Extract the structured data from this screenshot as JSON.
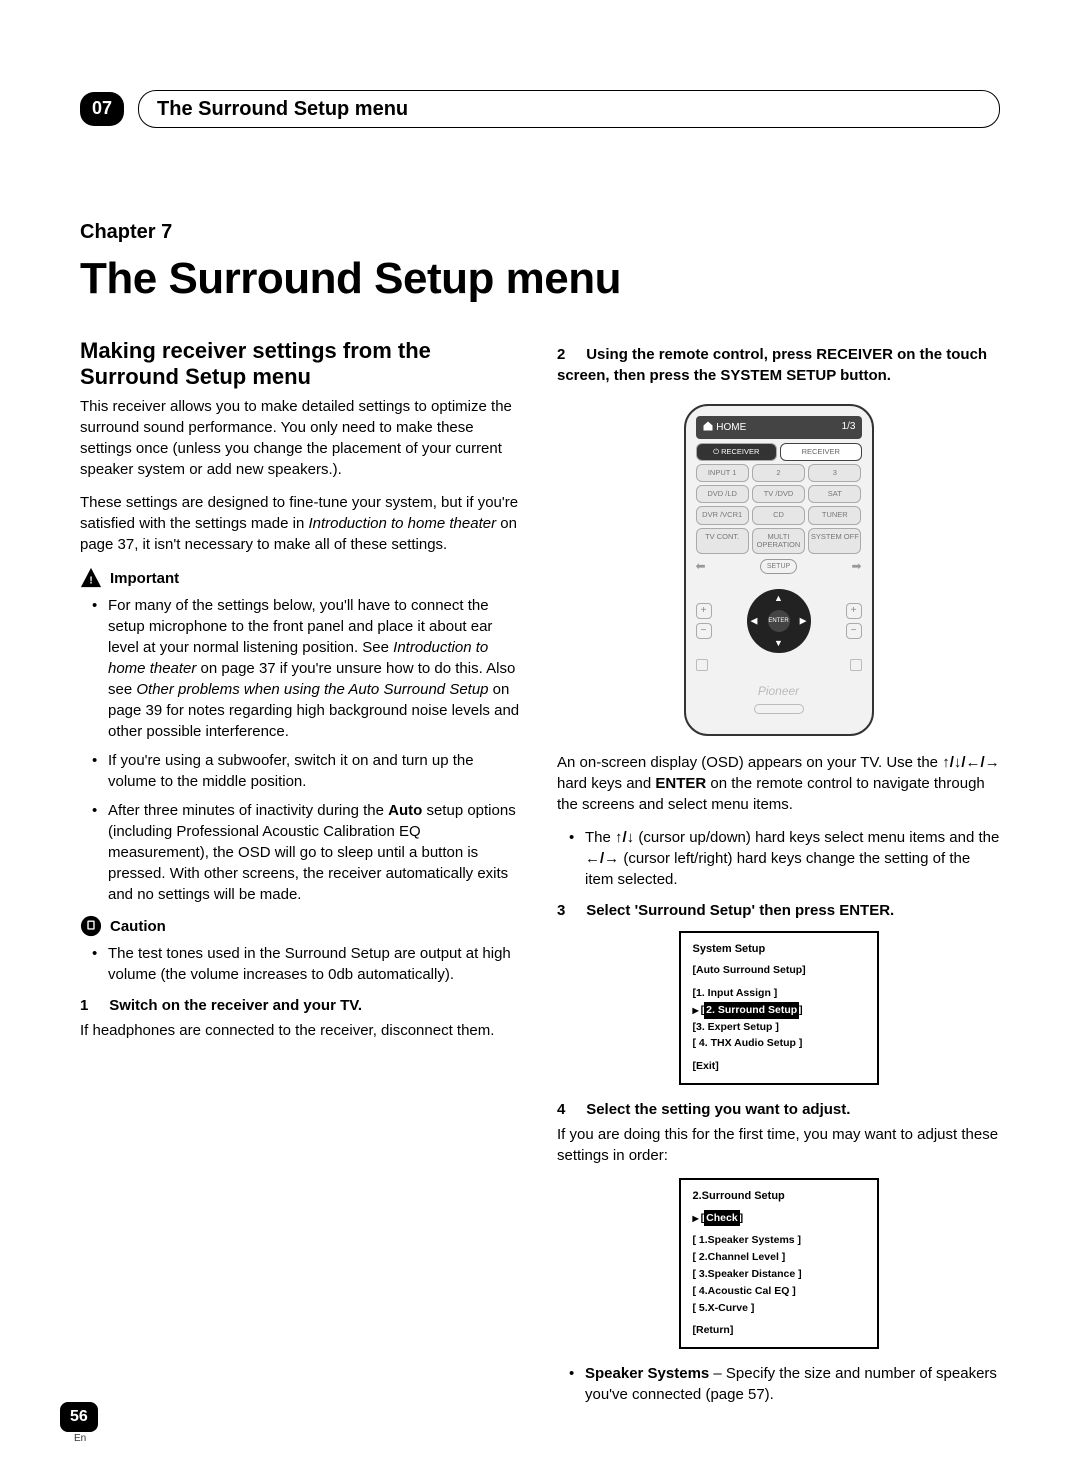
{
  "header": {
    "chapter_number_badge": "07",
    "header_title": "The Surround Setup menu"
  },
  "title_block": {
    "chapter_label": "Chapter 7",
    "chapter_title": "The Surround Setup menu"
  },
  "left": {
    "section_heading": "Making receiver settings from the Surround Setup menu",
    "para1": "This receiver allows you to make detailed settings to optimize the surround sound performance. You only need to make these settings once (unless you change the placement of your current speaker system or add new speakers.).",
    "para2_a": "These settings are designed to fine-tune your system, but if you're satisfied with the settings made in ",
    "para2_i": "Introduction to home theater",
    "para2_b": " on page 37, it isn't necessary to make all of these settings.",
    "important_label": "Important",
    "bullets_important": {
      "b1_a": "For many of the settings below, you'll have to connect the setup microphone to the front panel and place it about ear level at your normal listening position. See ",
      "b1_i1": "Introduction to home theater",
      "b1_b": " on page 37 if you're unsure how to do this. Also see ",
      "b1_i2": "Other problems when using the Auto Surround Setup",
      "b1_c": " on page 39 for notes regarding high background noise levels and other possible interference.",
      "b2": "If you're using a subwoofer, switch it on and turn up the volume to the middle position.",
      "b3_a": "After three minutes of inactivity during the ",
      "b3_bold": "Auto",
      "b3_b": " setup options (including Professional Acoustic Calibration EQ measurement), the OSD will go to sleep until a button is pressed. With other screens, the receiver automatically exits and no settings will be made."
    },
    "caution_label": "Caution",
    "bullets_caution": {
      "c1": "The test tones used in the Surround Setup are output at high volume (the volume increases to 0db automatically)."
    },
    "step1": {
      "num": "1",
      "text": "Switch on the receiver and your TV."
    },
    "step1_body": "If headphones are connected to the receiver, disconnect them."
  },
  "right": {
    "step2": {
      "num": "2",
      "text": "Using the remote control, press RECEIVER on the touch screen, then press the SYSTEM SETUP button."
    },
    "remote": {
      "home": "HOME",
      "page": "1/3",
      "btns": {
        "receiver_on": "RECEIVER",
        "receiver_off": "RECEIVER",
        "input1": "INPUT 1",
        "num2": "2",
        "num3": "3",
        "dvd": "DVD /LD",
        "tvdvd": "TV /DVD",
        "sat": "SAT",
        "dvr": "DVR /VCR1",
        "cd": "CD",
        "tuner": "TUNER",
        "tvcont": "TV CONT.",
        "multi": "MULTI OPERATION",
        "sysoff": "SYSTEM OFF",
        "setup": "SETUP"
      },
      "brand": "Pioneer",
      "sub": "RECEIVER"
    },
    "osd_intro_a": "An on-screen display (OSD) appears on your TV. Use the ",
    "osd_intro_arrows": "↑/↓/←/→",
    "osd_intro_b": " hard keys and ",
    "osd_intro_bold": "ENTER",
    "osd_intro_c": " on the remote control to navigate through the screens and select menu items.",
    "osd_bullet_a": "The ",
    "osd_bullet_arr1": "↑/↓",
    "osd_bullet_b": " (cursor up/down) hard keys select menu items and the ",
    "osd_bullet_arr2": "←/→",
    "osd_bullet_c": " (cursor left/right) hard keys change the setting of the item selected.",
    "step3": {
      "num": "3",
      "text": "Select 'Surround Setup' then press ENTER."
    },
    "osd1": {
      "title": "System  Setup",
      "auto": "[Auto Surround Setup]",
      "l1": "[1. Input Assign ]",
      "l2": "2. Surround Setup",
      "l3": "[3. Expert Setup ]",
      "l4": "[ 4. THX Audio Setup ]",
      "exit": "[Exit]"
    },
    "step4": {
      "num": "4",
      "text": "Select the setting you want to adjust."
    },
    "step4_body": "If you are doing this for the first time, you may want to adjust these settings in order:",
    "osd2": {
      "title": "2.Surround Setup",
      "check": "Check",
      "l1": "[ 1.Speaker Systems ]",
      "l2": "[ 2.Channel Level ]",
      "l3": "[ 3.Speaker Distance ]",
      "l4": "[ 4.Acoustic Cal EQ ]",
      "l5": "[ 5.X-Curve ]",
      "ret": "[Return]"
    },
    "tail_bullet_bold": "Speaker Systems",
    "tail_bullet_text": " – Specify the size and number of speakers you've connected (page 57)."
  },
  "footer": {
    "page": "56",
    "lang": "En"
  }
}
